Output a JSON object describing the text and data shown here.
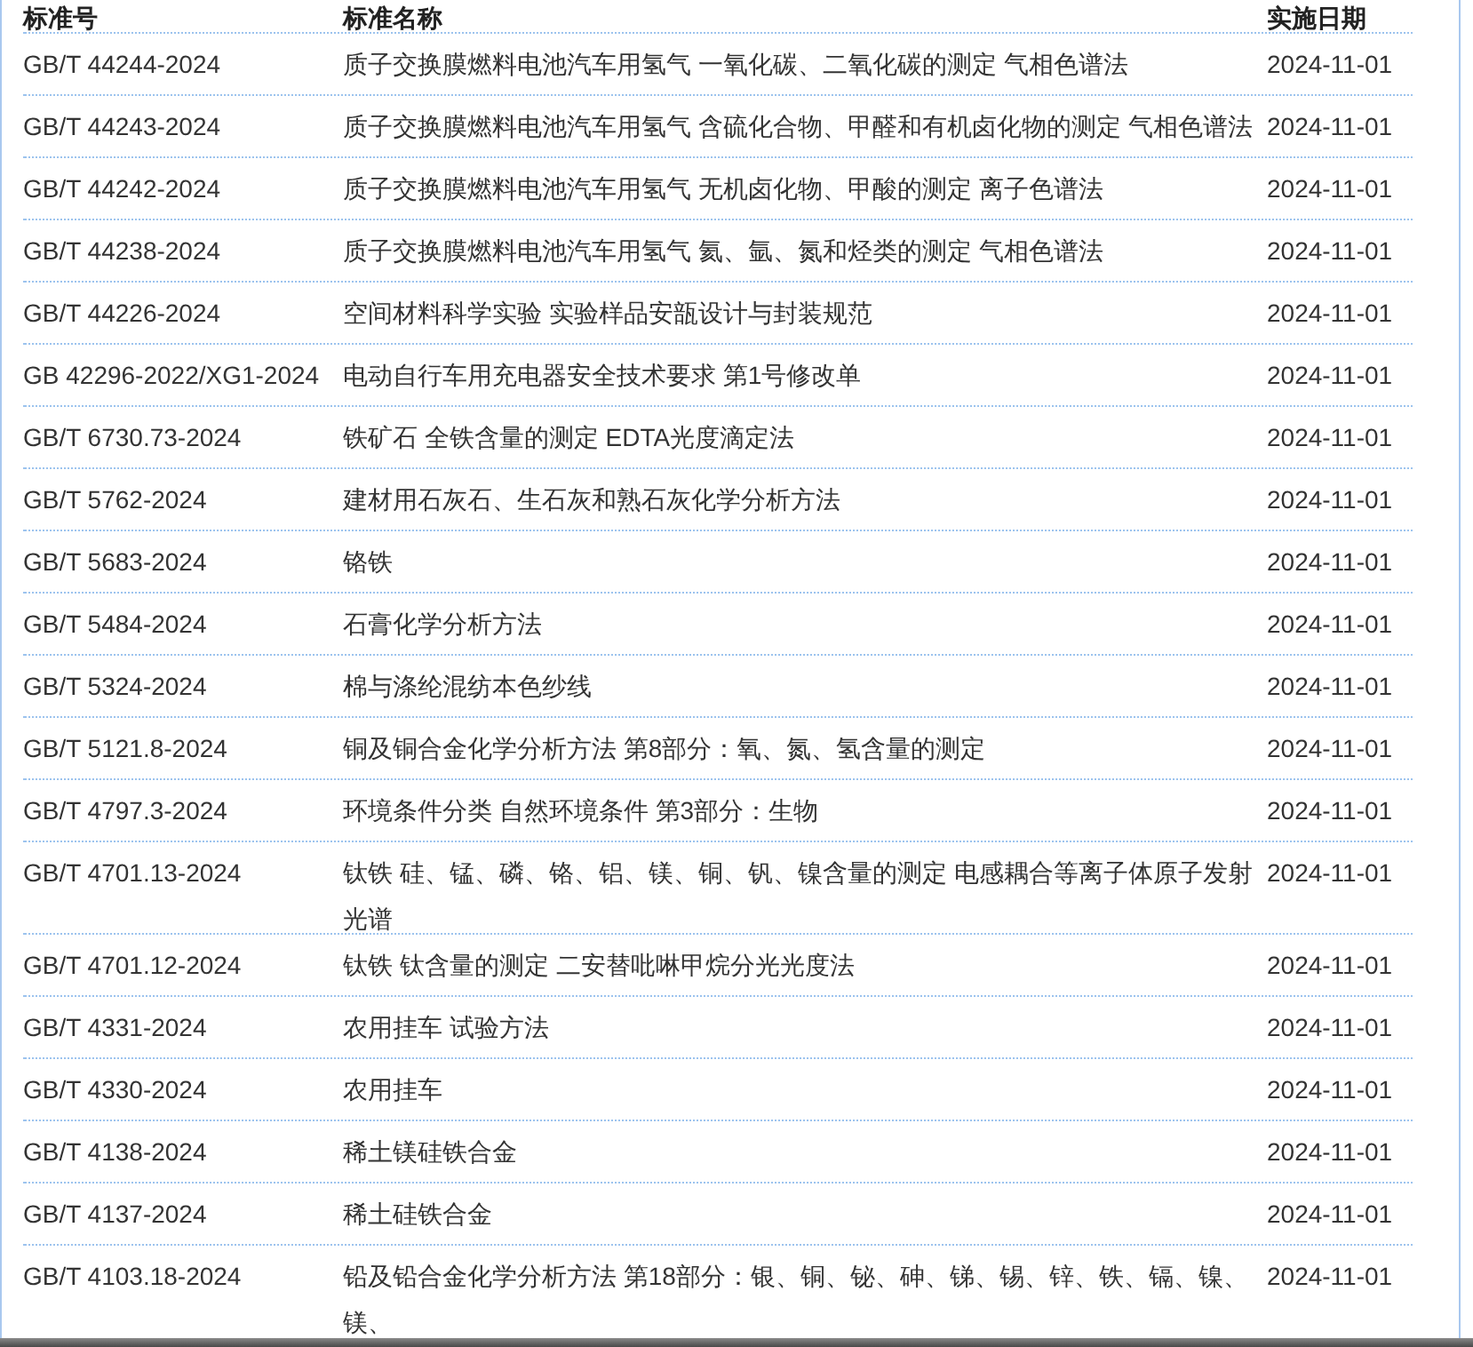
{
  "table": {
    "columns": [
      "标准号",
      "标准名称",
      "实施日期"
    ],
    "rows": [
      {
        "number": "GB/T 44244-2024",
        "name": "质子交换膜燃料电池汽车用氢气 一氧化碳、二氧化碳的测定 气相色谱法",
        "date": "2024-11-01"
      },
      {
        "number": "GB/T 44243-2024",
        "name": "质子交换膜燃料电池汽车用氢气 含硫化合物、甲醛和有机卤化物的测定 气相色谱法",
        "date": "2024-11-01"
      },
      {
        "number": "GB/T 44242-2024",
        "name": "质子交换膜燃料电池汽车用氢气 无机卤化物、甲酸的测定 离子色谱法",
        "date": "2024-11-01"
      },
      {
        "number": "GB/T 44238-2024",
        "name": "质子交换膜燃料电池汽车用氢气 氦、氩、氮和烃类的测定 气相色谱法",
        "date": "2024-11-01"
      },
      {
        "number": "GB/T 44226-2024",
        "name": "空间材料科学实验 实验样品安瓿设计与封装规范",
        "date": "2024-11-01"
      },
      {
        "number": "GB 42296-2022/XG1-2024",
        "name": "电动自行车用充电器安全技术要求 第1号修改单",
        "date": "2024-11-01"
      },
      {
        "number": "GB/T 6730.73-2024",
        "name": "铁矿石 全铁含量的测定 EDTA光度滴定法",
        "date": "2024-11-01"
      },
      {
        "number": "GB/T 5762-2024",
        "name": "建材用石灰石、生石灰和熟石灰化学分析方法",
        "date": "2024-11-01"
      },
      {
        "number": "GB/T 5683-2024",
        "name": "铬铁",
        "date": "2024-11-01"
      },
      {
        "number": "GB/T 5484-2024",
        "name": "石膏化学分析方法",
        "date": "2024-11-01"
      },
      {
        "number": "GB/T 5324-2024",
        "name": "棉与涤纶混纺本色纱线",
        "date": "2024-11-01"
      },
      {
        "number": "GB/T 5121.8-2024",
        "name": "铜及铜合金化学分析方法 第8部分：氧、氮、氢含量的测定",
        "date": "2024-11-01"
      },
      {
        "number": "GB/T 4797.3-2024",
        "name": "环境条件分类 自然环境条件 第3部分：生物",
        "date": "2024-11-01"
      },
      {
        "number": "GB/T 4701.13-2024",
        "name": "钛铁 硅、锰、磷、铬、铝、镁、铜、钒、镍含量的测定 电感耦合等离子体原子发射光谱",
        "date": "2024-11-01"
      },
      {
        "number": "GB/T 4701.12-2024",
        "name": "钛铁 钛含量的测定 二安替吡啉甲烷分光光度法",
        "date": "2024-11-01"
      },
      {
        "number": "GB/T 4331-2024",
        "name": "农用挂车 试验方法",
        "date": "2024-11-01"
      },
      {
        "number": "GB/T 4330-2024",
        "name": "农用挂车",
        "date": "2024-11-01"
      },
      {
        "number": "GB/T 4138-2024",
        "name": "稀土镁硅铁合金",
        "date": "2024-11-01"
      },
      {
        "number": "GB/T 4137-2024",
        "name": "稀土硅铁合金",
        "date": "2024-11-01"
      },
      {
        "number": "GB/T 4103.18-2024",
        "name": "铅及铅合金化学分析方法 第18部分：银、铜、铋、砷、锑、锡、锌、铁、镉、镍、镁、",
        "date": "2024-11-01"
      }
    ]
  }
}
